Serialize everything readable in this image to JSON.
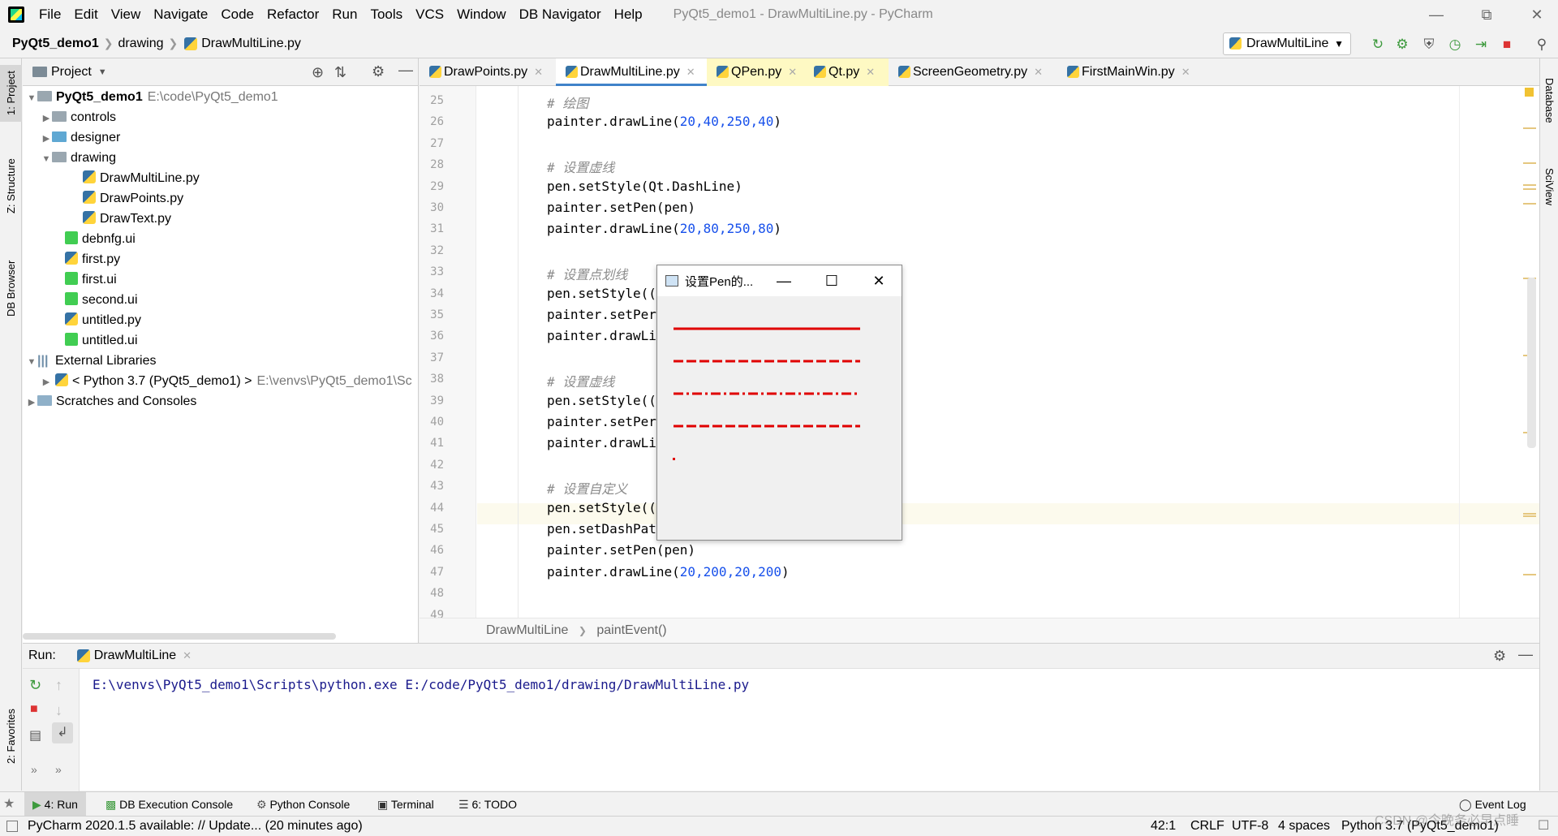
{
  "menu": {
    "items": [
      "File",
      "Edit",
      "View",
      "Navigate",
      "Code",
      "Refactor",
      "Run",
      "Tools",
      "VCS",
      "Window",
      "DB Navigator",
      "Help"
    ],
    "window_title": "PyQt5_demo1 - DrawMultiLine.py - PyCharm"
  },
  "nav": {
    "project": "PyQt5_demo1",
    "folder": "drawing",
    "file": "DrawMultiLine.py",
    "run_config": "DrawMultiLine"
  },
  "side_tabs": {
    "project": "1: Project",
    "structure": "Z: Structure",
    "db_browser": "DB Browser",
    "favorites": "2: Favorites",
    "database": "Database",
    "sciview": "SciView"
  },
  "project_panel": {
    "title": "Project",
    "root": {
      "name": "PyQt5_demo1",
      "path": "E:\\code\\PyQt5_demo1"
    },
    "items": [
      {
        "name": "controls"
      },
      {
        "name": "designer"
      },
      {
        "name": "drawing"
      },
      {
        "name": "DrawMultiLine.py"
      },
      {
        "name": "DrawPoints.py"
      },
      {
        "name": "DrawText.py"
      },
      {
        "name": "debnfg.ui"
      },
      {
        "name": "first.py"
      },
      {
        "name": "first.ui"
      },
      {
        "name": "second.ui"
      },
      {
        "name": "untitled.py"
      },
      {
        "name": "untitled.ui"
      },
      {
        "name": "External Libraries"
      },
      {
        "name": "< Python 3.7 (PyQt5_demo1) >",
        "path": "E:\\venvs\\PyQt5_demo1\\Sc"
      },
      {
        "name": "Scratches and Consoles"
      }
    ]
  },
  "tabs": [
    "DrawPoints.py",
    "DrawMultiLine.py",
    "QPen.py",
    "Qt.py",
    "ScreenGeometry.py",
    "FirstMainWin.py"
  ],
  "code": {
    "lines": [
      {
        "n": "25",
        "t": "# 绘图"
      },
      {
        "n": "26",
        "a": "painter.drawLine(",
        "b": "20,40,250,40",
        ")": ")"
      },
      {
        "n": "27"
      },
      {
        "n": "28",
        "t": "# 设置虚线"
      },
      {
        "n": "29",
        "a": "pen.setStyle(Qt.DashLine)"
      },
      {
        "n": "30",
        "a": "painter.setPen(pen)"
      },
      {
        "n": "31",
        "a": "painter.drawLine(",
        "b": "20,80,250,80"
      },
      {
        "n": "32"
      },
      {
        "n": "33",
        "t": "# 设置点划线"
      },
      {
        "n": "34",
        "a": "pen.setStyle(("
      },
      {
        "n": "35",
        "a": "painter.setPer"
      },
      {
        "n": "36",
        "a": "painter.drawLi"
      },
      {
        "n": "37"
      },
      {
        "n": "38",
        "t": "# 设置虚线"
      },
      {
        "n": "39",
        "a": "pen.setStyle(("
      },
      {
        "n": "40",
        "a": "painter.setPer"
      },
      {
        "n": "41",
        "a": "painter.drawLi"
      },
      {
        "n": "42"
      },
      {
        "n": "43",
        "t": "# 设置自定义"
      },
      {
        "n": "44",
        "a": "pen.setStyle(("
      },
      {
        "n": "45",
        "a": "pen.setDashPat"
      },
      {
        "n": "46",
        "a": "painter.setPen(pen)"
      },
      {
        "n": "47",
        "a": "painter.drawLine(",
        "b": "20,200,20,200"
      },
      {
        "n": "48"
      },
      {
        "n": "49"
      }
    ]
  },
  "editor_breadcrumb": {
    "cls": "DrawMultiLine",
    "fn": "paintEvent()"
  },
  "dialog": {
    "title": "设置Pen的...",
    "line_color": "#e00000"
  },
  "run": {
    "label": "Run:",
    "tab": "DrawMultiLine",
    "output": "E:\\venvs\\PyQt5_demo1\\Scripts\\python.exe E:/code/PyQt5_demo1/drawing/DrawMultiLine.py"
  },
  "toolwindows": [
    "4: Run",
    "DB Execution Console",
    "Python Console",
    "Terminal",
    "6: TODO",
    "Event Log"
  ],
  "status": {
    "message": "PyCharm 2020.1.5 available: // Update... (20 minutes ago)",
    "position": "42:1",
    "line_sep": "CRLF",
    "encoding": "UTF-8",
    "indent": "4 spaces",
    "interpreter": "Python 3.7 (PyQt5_demo1)",
    "watermark": "CSDN @今晚务必早点睡"
  }
}
